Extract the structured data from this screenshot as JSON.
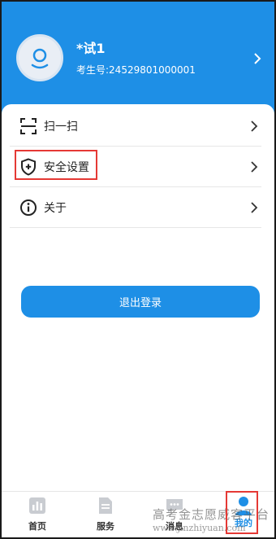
{
  "header": {
    "user_name": "*试1",
    "exam_id": "考生号:24529801000001"
  },
  "menu": [
    {
      "label": "扫一扫",
      "icon": "scan-icon"
    },
    {
      "label": "安全设置",
      "icon": "shield-plus-icon"
    },
    {
      "label": "关于",
      "icon": "info-icon"
    }
  ],
  "logout_label": "退出登录",
  "tabs": [
    {
      "label": "首页",
      "icon": "home-chart-icon"
    },
    {
      "label": "服务",
      "icon": "document-icon"
    },
    {
      "label": "消息",
      "icon": "message-icon"
    },
    {
      "label": "我的",
      "icon": "person-icon",
      "active": true
    }
  ],
  "watermark": {
    "line1": "高考金志愿威客平台",
    "line2": "www.jinzhiyuan.com"
  },
  "colors": {
    "primary": "#1e8fe6",
    "highlight": "#e53935"
  }
}
